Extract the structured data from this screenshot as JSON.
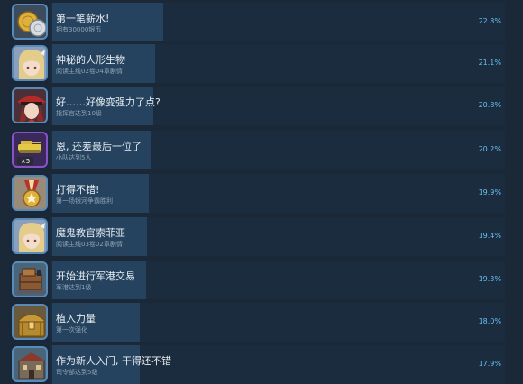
{
  "achievements": [
    {
      "title": "第一笔薪水!",
      "desc": "拥有30000银币",
      "percent": "22.8%",
      "ratio": 0.228,
      "icon": "coins-icon",
      "frame": "#5a8bb8"
    },
    {
      "title": "神秘的人形生物",
      "desc": "阅读主线02卷04章剧情",
      "percent": "21.1%",
      "ratio": 0.211,
      "icon": "blonde-girl-portrait-icon",
      "frame": "#5a8bb8"
    },
    {
      "title": "好……好像变强力了点?",
      "desc": "指挥官达到10级",
      "percent": "20.8%",
      "ratio": 0.208,
      "icon": "red-hat-commander-portrait-icon",
      "frame": "#5a8bb8"
    },
    {
      "title": "恩, 还差最后一位了",
      "desc": "小队达到5人",
      "percent": "20.2%",
      "ratio": 0.202,
      "icon": "tank-x5-icon",
      "frame": "#8a52c8",
      "badge": "×5"
    },
    {
      "title": "打得不错!",
      "desc": "第一场银河争霸胜利",
      "percent": "19.9%",
      "ratio": 0.199,
      "icon": "medal-icon",
      "frame": "#5a8bb8"
    },
    {
      "title": "魔鬼教官索菲亚",
      "desc": "阅读主线03卷02章剧情",
      "percent": "19.4%",
      "ratio": 0.194,
      "icon": "blonde-girl-portrait-icon",
      "frame": "#5a8bb8"
    },
    {
      "title": "开始进行军港交易",
      "desc": "军港达到1级",
      "percent": "19.3%",
      "ratio": 0.193,
      "icon": "harbor-crate-icon",
      "frame": "#5a8bb8"
    },
    {
      "title": "植入力量",
      "desc": "第一次强化",
      "percent": "18.0%",
      "ratio": 0.18,
      "icon": "treasure-chest-icon",
      "frame": "#5a8bb8"
    },
    {
      "title": "作为新人入门, 干得还不错",
      "desc": "司令部达到5级",
      "percent": "17.9%",
      "ratio": 0.179,
      "icon": "headquarters-icon",
      "frame": "#5a8bb8"
    }
  ]
}
